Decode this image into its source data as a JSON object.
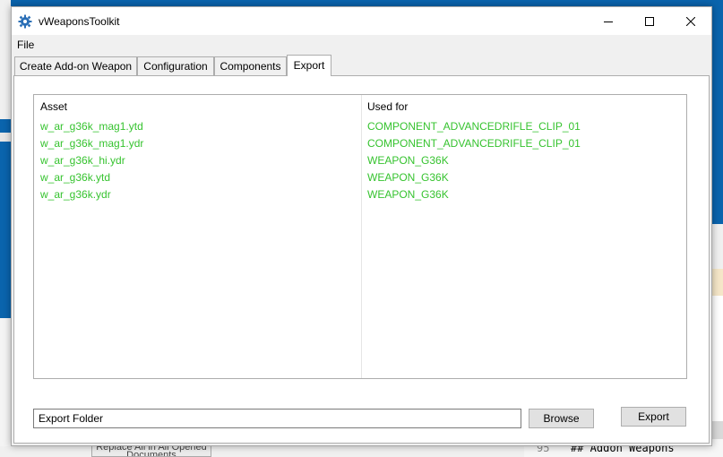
{
  "window": {
    "title": "vWeaponsToolkit"
  },
  "menu": {
    "file": "File"
  },
  "tabs": [
    {
      "label": "Create Add-on Weapon",
      "active": false
    },
    {
      "label": "Configuration",
      "active": false
    },
    {
      "label": "Components",
      "active": false
    },
    {
      "label": "Export",
      "active": true
    }
  ],
  "listview": {
    "columns": [
      "Asset",
      "Used for"
    ],
    "rows": [
      {
        "asset": "w_ar_g36k_mag1.ytd",
        "used_for": "COMPONENT_ADVANCEDRIFLE_CLIP_01"
      },
      {
        "asset": "w_ar_g36k_mag1.ydr",
        "used_for": "COMPONENT_ADVANCEDRIFLE_CLIP_01"
      },
      {
        "asset": "w_ar_g36k_hi.ydr",
        "used_for": "WEAPON_G36K"
      },
      {
        "asset": "w_ar_g36k.ytd",
        "used_for": "WEAPON_G36K"
      },
      {
        "asset": "w_ar_g36k.ydr",
        "used_for": "WEAPON_G36K"
      }
    ],
    "row_color": "#36c32f"
  },
  "export_folder": {
    "value": "Export Folder"
  },
  "buttons": {
    "browse": "Browse",
    "export": "Export"
  },
  "background": {
    "editor_line_number": "95",
    "editor_code": "## Addon Weapons",
    "desktop_button": "Replace All in All Opened Documents"
  },
  "colors": {
    "accent_blue": "#0a64ad",
    "window_bg": "#f0f0f0",
    "asset_text": "#36c32f"
  },
  "icons": {
    "app": "gear-icon",
    "minimize": "minimize-icon",
    "maximize": "maximize-icon",
    "close": "close-icon"
  }
}
